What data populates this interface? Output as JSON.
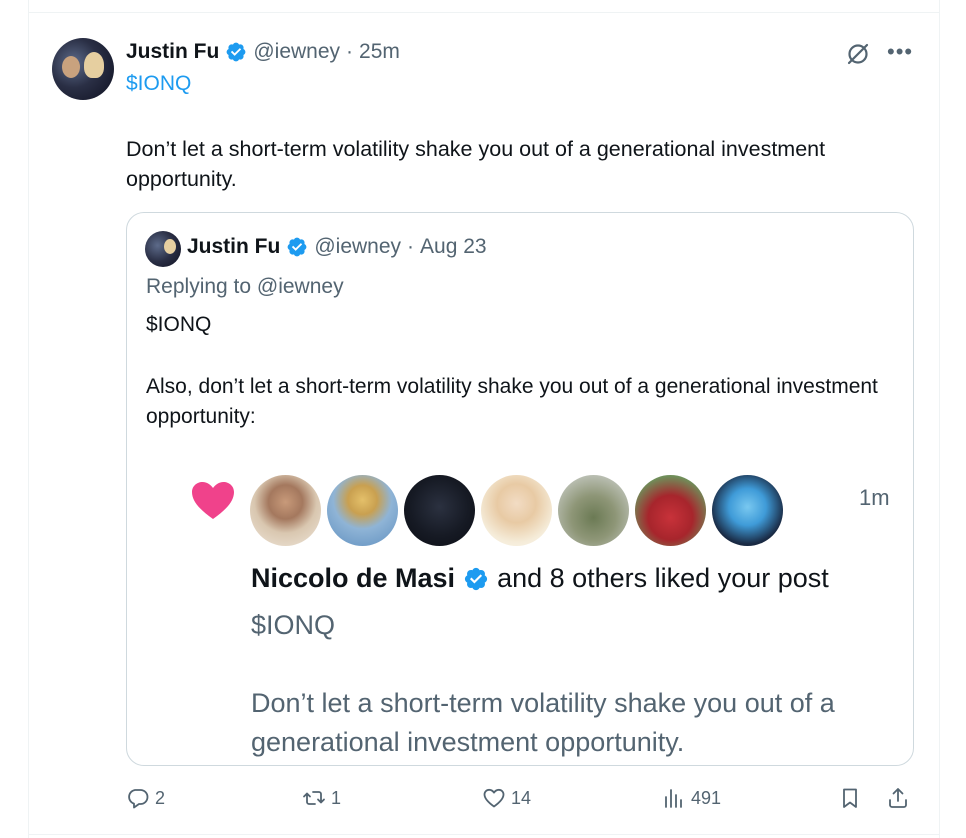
{
  "tweet": {
    "author_name": "Justin Fu",
    "handle": "@iewney",
    "separator": "·",
    "time": "25m",
    "cashtag": "$IONQ",
    "body": "Don’t let a short-term volatility shake you out of a generational investment opportunity."
  },
  "quoted_tweet": {
    "author_name": "Justin Fu",
    "handle": "@iewney",
    "separator": "·",
    "time": "Aug 23",
    "replying_to": "Replying to @iewney",
    "cashtag": "$IONQ",
    "body": "Also, don’t let a short-term volatility shake you out of a generational investment opportunity:"
  },
  "notification_screenshot": {
    "time": "1m",
    "liker_name": "Niccolo de Masi",
    "liked_text": "and 8 others liked your post",
    "cashtag": "$IONQ",
    "post_text": "Don’t let a short-term volatility shake you out of a generational investment opportunity.",
    "liker_avatar_count": 8
  },
  "actions": {
    "replies": "2",
    "reposts": "1",
    "likes": "14",
    "views": "491"
  },
  "colors": {
    "accent": "#1d9bf0",
    "secondary_text": "#536471",
    "heart": "#f0428b",
    "border": "#cfd9de"
  },
  "icons": [
    "verified-badge-icon",
    "grok-icon",
    "more-icon",
    "heart-icon",
    "reply-icon",
    "repost-icon",
    "like-icon",
    "views-icon",
    "bookmark-icon",
    "share-icon"
  ]
}
